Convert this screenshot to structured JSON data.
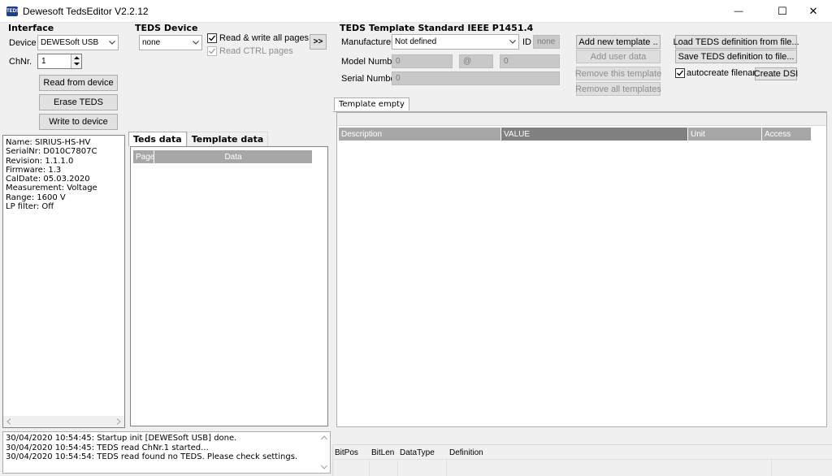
{
  "window": {
    "title": "Dewesoft TedsEditor V2.2.12",
    "icon_text": "TEDS",
    "minimize_glyph": "—",
    "maximize_glyph": "☐",
    "close_glyph": "✕"
  },
  "interface": {
    "title": "Interface",
    "device_label": "Device",
    "device_value": "DEWESoft USB",
    "chnr_label": "ChNr.",
    "chnr_value": "1",
    "read_button": "Read from device",
    "erase_button": "Erase TEDS",
    "write_button": "Write to device"
  },
  "teds_device": {
    "title": "TEDS Device",
    "select_value": "none",
    "read_write_all_label": "Read & write all pages",
    "read_write_all_checked": true,
    "read_ctrl_label": "Read CTRL pages",
    "read_ctrl_checked": true,
    "arrow_button": ">>"
  },
  "sensor_info": [
    "Name: SIRIUS-HS-HV",
    "SerialNr: D010C7807C",
    "Revision: 1.1.1.0",
    "Firmware: 1.3",
    "CalDate: 05.03.2020",
    "Measurement: Voltage",
    "Range: 1600 V",
    "LP filter: Off"
  ],
  "teds_tabs": {
    "teds_data": "Teds data",
    "template_data": "Template data",
    "columns": [
      "Page",
      "Data"
    ]
  },
  "template": {
    "title": "TEDS Template Standard IEEE P1451.4",
    "manufacturer_label": "Manufacturer",
    "manufacturer_value": "Not defined",
    "id_label": "ID",
    "id_value": "none",
    "model_label": "Model Number",
    "model_value": "0",
    "model_at": "@",
    "model_value2": "0",
    "serial_label": "Serial Number",
    "serial_value": "0",
    "add_new_template": "Add new template ..",
    "add_user_data": "Add user data",
    "remove_this_template": "Remove this template",
    "remove_all_templates": "Remove all templates",
    "load_teds": "Load TEDS definition from file...",
    "save_teds": "Save TEDS definition to file...",
    "autocreate_label": "autocreate filename",
    "autocreate_checked": true,
    "create_dsi": "Create DSI",
    "tab_label": "Template empty",
    "columns": [
      "Description",
      "VALUE",
      "Unit",
      "Access"
    ]
  },
  "log": [
    "30/04/2020 10:54:45: Startup init [DEWESoft USB] done.",
    "30/04/2020 10:54:45: TEDS read ChNr.1 started...",
    "30/04/2020 10:54:54: TEDS read found no TEDS. Please check settings."
  ],
  "bottom_columns": [
    "BitPos",
    "BitLen",
    "DataType",
    "Definition"
  ]
}
